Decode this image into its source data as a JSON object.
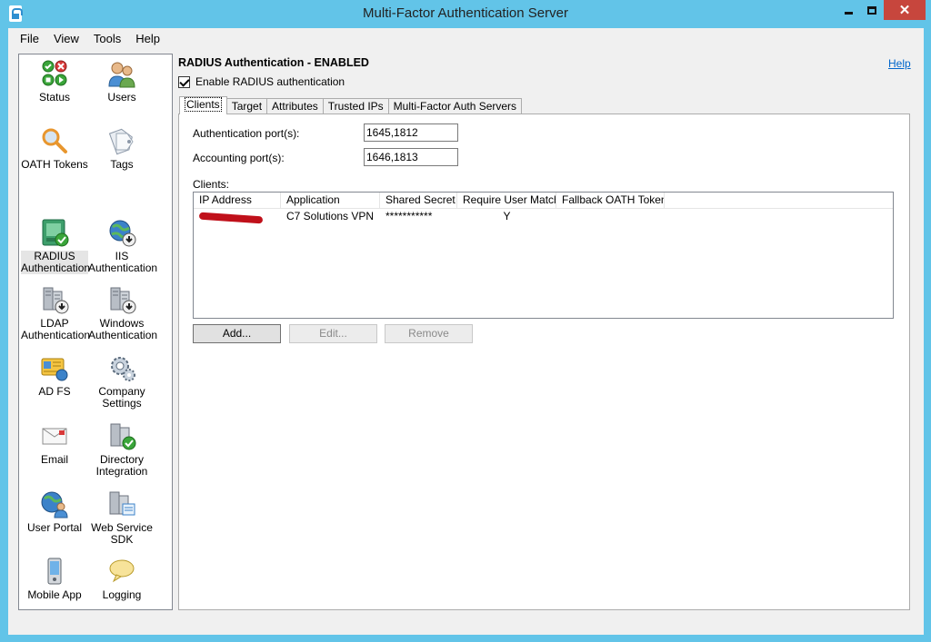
{
  "window": {
    "title": "Multi-Factor Authentication Server",
    "close_glyph": "✕"
  },
  "menu": [
    "File",
    "View",
    "Tools",
    "Help"
  ],
  "sidebar": {
    "items": [
      {
        "label": "Status",
        "icon": "status-icon"
      },
      {
        "label": "Users",
        "icon": "users-icon"
      },
      {
        "label": "OATH Tokens",
        "icon": "oath-tokens-icon"
      },
      {
        "label": "Tags",
        "icon": "tags-icon"
      },
      {
        "label": "RADIUS Authentication",
        "icon": "radius-icon",
        "selected": true
      },
      {
        "label": "IIS Authentication",
        "icon": "iis-icon"
      },
      {
        "label": "LDAP Authentication",
        "icon": "ldap-icon"
      },
      {
        "label": "Windows Authentication",
        "icon": "windows-auth-icon"
      },
      {
        "label": "AD FS",
        "icon": "adfs-icon"
      },
      {
        "label": "Company Settings",
        "icon": "company-settings-icon"
      },
      {
        "label": "Email",
        "icon": "email-icon"
      },
      {
        "label": "Directory Integration",
        "icon": "directory-integration-icon"
      },
      {
        "label": "User Portal",
        "icon": "user-portal-icon"
      },
      {
        "label": "Web Service SDK",
        "icon": "web-service-sdk-icon"
      },
      {
        "label": "Mobile App",
        "icon": "mobile-app-icon"
      },
      {
        "label": "Logging",
        "icon": "logging-icon"
      }
    ]
  },
  "content": {
    "title": "RADIUS Authentication - ENABLED",
    "help": "Help",
    "enable_label": "Enable RADIUS authentication",
    "enable_checked": true,
    "tabs": [
      "Clients",
      "Target",
      "Attributes",
      "Trusted IPs",
      "Multi-Factor Auth Servers"
    ],
    "active_tab": "Clients",
    "auth_ports_label": "Authentication port(s):",
    "auth_ports_value": "1645,1812",
    "acct_ports_label": "Accounting port(s):",
    "acct_ports_value": "1646,1813",
    "clients_label": "Clients:",
    "clients_table": {
      "columns": [
        "IP Address",
        "Application",
        "Shared Secret",
        "Require User Match",
        "Fallback OATH Token"
      ],
      "rows": [
        {
          "ip": "",
          "application": "C7 Solutions VPN",
          "secret": "***********",
          "require_match": "Y",
          "fallback": ""
        }
      ]
    },
    "buttons": {
      "add": "Add...",
      "edit": "Edit...",
      "remove": "Remove"
    }
  },
  "colors": {
    "title_bar": "#62c4e8",
    "close_button": "#c7463d",
    "link": "#0066cc",
    "redaction": "#c0101a"
  }
}
